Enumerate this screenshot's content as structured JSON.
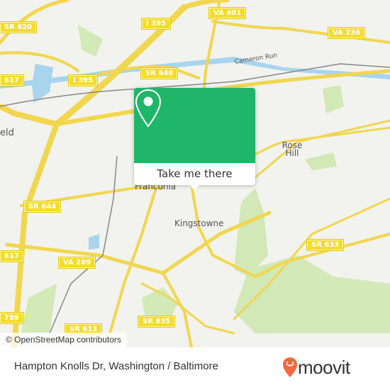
{
  "map": {
    "attribution": "© OpenStreetMap contributors",
    "place_labels": [
      {
        "id": "franconia",
        "text": "Franconia"
      },
      {
        "id": "kingstowne",
        "text": "Kingstowne"
      },
      {
        "id": "rose-hill",
        "text": "Rose\nHill"
      },
      {
        "id": "springfield",
        "text": "eld"
      },
      {
        "id": "cameron-run",
        "text": "Cameron Run"
      }
    ],
    "road_shields": [
      {
        "id": "sr620",
        "text": "SR 620"
      },
      {
        "id": "i395-top",
        "text": "I 395"
      },
      {
        "id": "va401",
        "text": "VA 401"
      },
      {
        "id": "va236",
        "text": "VA 236"
      },
      {
        "id": "sr617-top",
        "text": "617"
      },
      {
        "id": "i395-mid",
        "text": "I 395"
      },
      {
        "id": "sr648",
        "text": "SR 648"
      },
      {
        "id": "sr644",
        "text": "SR 644"
      },
      {
        "id": "sr617-mid",
        "text": "617"
      },
      {
        "id": "va289",
        "text": "VA 289"
      },
      {
        "id": "sr633",
        "text": "SR 633"
      },
      {
        "id": "sr789",
        "text": "789"
      },
      {
        "id": "sr613",
        "text": "SR 613"
      },
      {
        "id": "sr635",
        "text": "SR 635"
      }
    ]
  },
  "popup": {
    "button_label": "Take me there",
    "accent_color": "#1fb66a"
  },
  "footer": {
    "location_title": "Hampton Knolls Dr, Washington / Baltimore",
    "brand": "moovit",
    "brand_color": "#f26a3d"
  }
}
